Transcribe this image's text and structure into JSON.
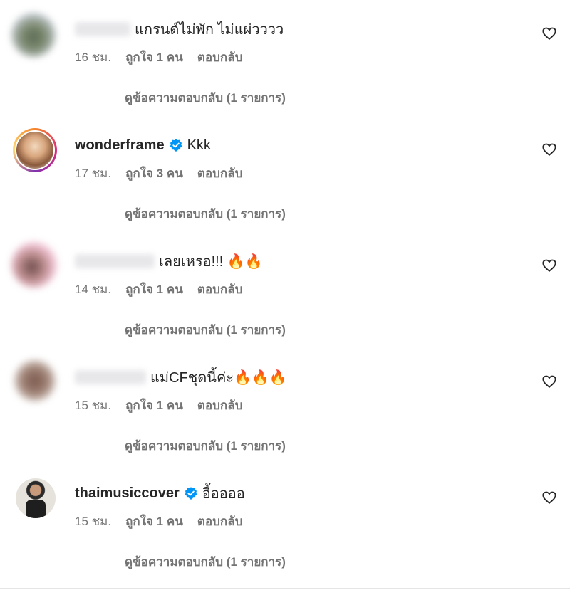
{
  "comments": [
    {
      "username": "lillingsr",
      "username_blurred": true,
      "verified": false,
      "text": "แกรนด์ไม่พัก ไม่แผ่วววว",
      "time": "16 ชม.",
      "likes": "ถูกใจ 1 คน",
      "reply": "ตอบกลับ",
      "view_replies": "ดูข้อความตอบกลับ (1 รายการ)",
      "avatar_colors": [
        "#bfc6cc",
        "#5a6a55"
      ]
    },
    {
      "username": "wonderframe",
      "username_blurred": false,
      "verified": true,
      "text": "Kkk",
      "time": "17 ชม.",
      "likes": "ถูกใจ 3 คน",
      "reply": "ตอบกลับ",
      "view_replies": "ดูข้อความตอบกลับ (1 รายการ)",
      "avatar_colors": [
        "#e9c9a8",
        "#8a5a3c"
      ]
    },
    {
      "username": "paopaoo66",
      "username_blurred": true,
      "verified": false,
      "text": "เลยเหรอ!!! 🔥🔥",
      "time": "14 ชม.",
      "likes": "ถูกใจ 1 คน",
      "reply": "ตอบกลับ",
      "view_replies": "ดูข้อความตอบกลับ (1 รายการ)",
      "avatar_colors": [
        "#f2c6d8",
        "#6b4a4a"
      ]
    },
    {
      "username": "rosesthin",
      "username_blurred": true,
      "verified": false,
      "text": "แม่CFชุดนี้ค่ะ🔥🔥🔥",
      "time": "15 ชม.",
      "likes": "ถูกใจ 1 คน",
      "reply": "ตอบกลับ",
      "view_replies": "ดูข้อความตอบกลับ (1 รายการ)",
      "avatar_colors": [
        "#d8cfc9",
        "#7a5a4e"
      ]
    },
    {
      "username": "thaimusiccover",
      "username_blurred": false,
      "verified": true,
      "text": "อื้ออออ",
      "time": "15 ชม.",
      "likes": "ถูกใจ 1 คน",
      "reply": "ตอบกลับ",
      "view_replies": "ดูข้อความตอบกลับ (1 รายการ)",
      "avatar_colors": [
        "#e6e2dc",
        "#1e1e1e"
      ]
    }
  ],
  "colors": {
    "text": "#262626",
    "secondary": "#737373",
    "verified": "#0095f6"
  }
}
